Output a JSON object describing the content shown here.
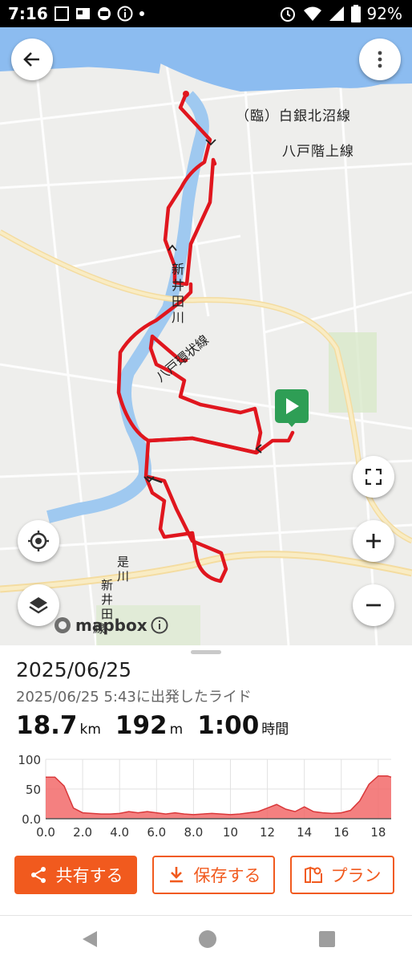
{
  "status_bar": {
    "time": "7:16",
    "battery": "92%"
  },
  "map": {
    "road_labels": [
      "（臨）白銀北沼線",
      "八戸階上線",
      "新",
      "井",
      "田",
      "川",
      "八戸環状線",
      "是",
      "川",
      "新",
      "井",
      "田",
      "線"
    ],
    "attribution": "mapbox",
    "start_marker_icon": "play-icon",
    "colors": {
      "route": "#e0161e",
      "river": "#9fc9f0",
      "sea": "#8cbcf0",
      "road_major": "#f7e6a6",
      "start_marker": "#2e9e55"
    }
  },
  "ride": {
    "date": "2025/06/25",
    "subtitle": "2025/06/25 5:43に出発したライド",
    "distance": "18.7",
    "distance_unit": "km",
    "elevation": "192",
    "elevation_unit": "m",
    "duration": "1:00",
    "duration_unit": "時間"
  },
  "chart_data": {
    "type": "area",
    "x": [
      0,
      0.5,
      1,
      1.5,
      2,
      2.5,
      3,
      3.5,
      4,
      4.5,
      5,
      5.5,
      6,
      6.5,
      7,
      7.5,
      8,
      8.5,
      9,
      9.5,
      10,
      10.5,
      11,
      11.5,
      12,
      12.5,
      13,
      13.5,
      14,
      14.5,
      15,
      15.5,
      16,
      16.5,
      17,
      17.5,
      18,
      18.5,
      18.7
    ],
    "series": [
      {
        "values": [
          70,
          70,
          55,
          18,
          10,
          9,
          8,
          8,
          9,
          12,
          10,
          12,
          10,
          8,
          10,
          8,
          7,
          8,
          9,
          8,
          7,
          8,
          10,
          12,
          18,
          24,
          16,
          12,
          20,
          12,
          10,
          9,
          10,
          14,
          30,
          58,
          72,
          72,
          70
        ]
      }
    ],
    "xlim": [
      0,
      18.7
    ],
    "ylim": [
      0,
      100
    ],
    "xticks": [
      "0.0",
      "2.0",
      "4.0",
      "6.0",
      "8.0",
      "10",
      "12",
      "14",
      "16",
      "18"
    ],
    "yticks": [
      "0.0",
      "50",
      "100"
    ],
    "color": "#f26a6a"
  },
  "actions": {
    "share": "共有する",
    "save": "保存する",
    "plan": "プラン"
  }
}
